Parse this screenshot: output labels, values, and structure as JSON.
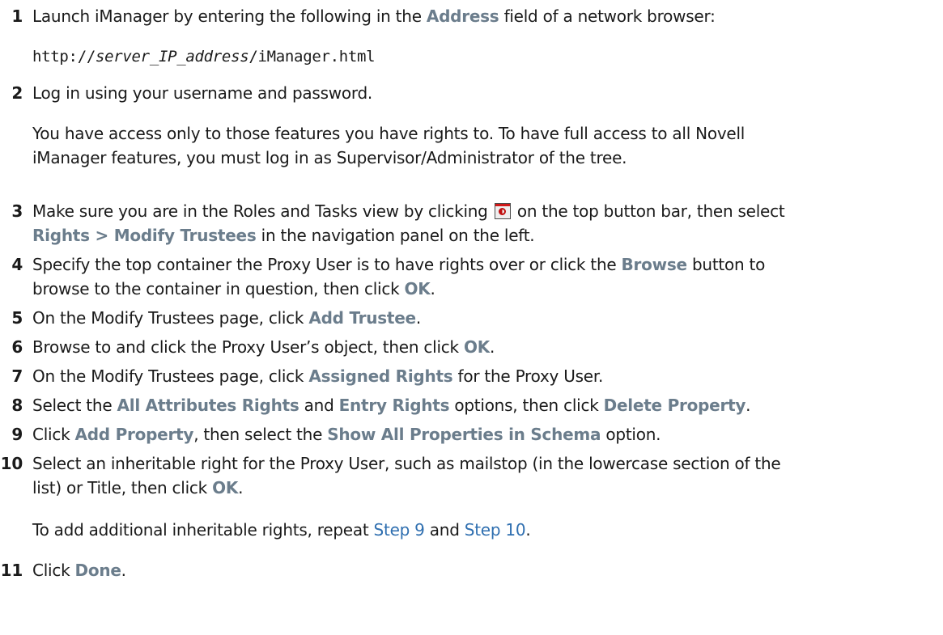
{
  "steps": {
    "s1": {
      "num": "1",
      "a": "Launch iManager by entering the following in the ",
      "ui1": "Address",
      "b": " field of a network browser:",
      "code_pre": "http://",
      "code_var": "server_IP_address",
      "code_post": "/iManager.html"
    },
    "s2": {
      "num": "2",
      "text": "Log in using your username and password.",
      "note_line1": "You have access only to those features you have rights to. To have full access to all Novell",
      "note_line2": "iManager features, you must log in as Supervisor/Administrator of the tree."
    },
    "s3": {
      "num": "3",
      "a": "Make sure you are in the Roles and Tasks view by clicking",
      "icon": "roles-and-tasks-icon",
      "b": " on the top button bar, then select",
      "ui1": "Rights > Modify Trustees",
      "c": " in the navigation panel on the left."
    },
    "s4": {
      "num": "4",
      "a": "Specify the top container the Proxy User is to have rights over or click the ",
      "ui1": "Browse",
      "b": " button to",
      "c": "browse to the container in question, then click ",
      "ui2": "OK",
      "d": "."
    },
    "s5": {
      "num": "5",
      "a": "On the Modify Trustees page, click ",
      "ui1": "Add Trustee",
      "b": "."
    },
    "s6": {
      "num": "6",
      "a": "Browse to and click the Proxy User’s object, then click ",
      "ui1": "OK",
      "b": "."
    },
    "s7": {
      "num": "7",
      "a": "On the Modify Trustees page, click ",
      "ui1": "Assigned Rights",
      "b": " for the Proxy User."
    },
    "s8": {
      "num": "8",
      "a": "Select the ",
      "ui1": "All Attributes Rights",
      "b": " and ",
      "ui2": "Entry Rights",
      "c": " options, then click ",
      "ui3": "Delete Property",
      "d": "."
    },
    "s9": {
      "num": "9",
      "a": "Click ",
      "ui1": "Add Property",
      "b": ", then select the ",
      "ui2": "Show All Properties in Schema",
      "c": " option."
    },
    "s10": {
      "num": "10",
      "a": "Select an inheritable right for the Proxy User, such as mailstop (in the lowercase section of the",
      "b": "list) or Title, then click ",
      "ui1": "OK",
      "c": ".",
      "note_a": "To add additional inheritable rights, repeat ",
      "link1": "Step 9",
      "note_b": " and ",
      "link2": "Step 10",
      "note_c": "."
    },
    "s11": {
      "num": "11",
      "a": "Click ",
      "ui1": "Done",
      "b": "."
    }
  },
  "colors": {
    "ui_label": "#6b7d8c",
    "link": "#2f6fb0",
    "text": "#1a1a1a"
  }
}
